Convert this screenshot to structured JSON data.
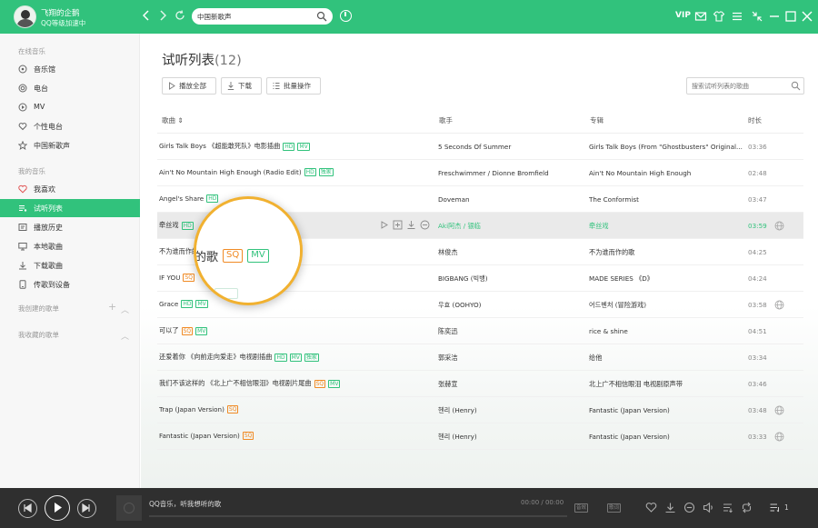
{
  "user": {
    "name": "飞翔的企鹅",
    "status": "QQ等级加速中"
  },
  "search": {
    "value": "中国新歌声"
  },
  "header": {
    "vip": "VIP"
  },
  "sidebar": {
    "section_online": "在线音乐",
    "online_items": [
      {
        "label": "音乐馆",
        "icon": "music-hall-icon"
      },
      {
        "label": "电台",
        "icon": "radio-icon"
      },
      {
        "label": "MV",
        "icon": "mv-icon"
      },
      {
        "label": "个性电台",
        "icon": "heart-radio-icon"
      },
      {
        "label": "中国新歌声",
        "icon": "star-icon"
      }
    ],
    "section_my": "我的音乐",
    "my_items": [
      {
        "label": "我喜欢",
        "icon": "heart-icon"
      },
      {
        "label": "试听列表",
        "icon": "list-icon"
      },
      {
        "label": "播放历史",
        "icon": "history-icon"
      },
      {
        "label": "本地歌曲",
        "icon": "monitor-icon"
      },
      {
        "label": "下载歌曲",
        "icon": "download-icon"
      },
      {
        "label": "传歌到设备",
        "icon": "device-icon"
      }
    ],
    "section_created": "我创建的歌单",
    "section_collected": "我收藏的歌单"
  },
  "page": {
    "title": "试听列表",
    "count": "(12)",
    "play_all": "播放全部",
    "download": "下载",
    "batch": "批量操作",
    "search_placeholder": "搜索试听列表的歌曲"
  },
  "table": {
    "headers": {
      "song": "歌曲 ⇕",
      "singer": "歌手",
      "album": "专辑",
      "duration": "时长"
    },
    "rows": [
      {
        "song": "Girls Talk Boys 《超能敢死队》电影插曲",
        "tags": [
          "HD",
          "MV"
        ],
        "singer": "5 Seconds Of Summer",
        "album": "Girls Talk Boys (From \"Ghostbusters\" Original...",
        "duration": "03:36",
        "globe": false
      },
      {
        "song": "Ain't No Mountain High Enough (Radio Edit)",
        "tags": [
          "HD",
          "独家"
        ],
        "singer": "Freschwimmer / Dionne Bromfield",
        "album": "Ain't No Mountain High Enough",
        "duration": "02:48",
        "globe": false
      },
      {
        "song": "Angel's Share",
        "tags": [
          "HD"
        ],
        "singer": "Doveman",
        "album": "The Conformist",
        "duration": "03:47",
        "globe": false
      },
      {
        "song": "牵丝戏",
        "tags": [
          "HD"
        ],
        "singer": "Aki阿杰 / 银临",
        "album": "牵丝戏",
        "duration": "03:59",
        "globe": true,
        "hover": true
      },
      {
        "song": "不为谁而作的歌",
        "tags": [
          "SQ",
          "MV"
        ],
        "singer": "林俊杰",
        "album": "不为谁而作的歌",
        "duration": "04:25",
        "globe": false
      },
      {
        "song": "IF YOU",
        "tags": [
          "SQ"
        ],
        "singer": "BIGBANG (빅뱅)",
        "album": "MADE SERIES 《D》",
        "duration": "04:24",
        "globe": false
      },
      {
        "song": "Grace",
        "tags": [
          "HD",
          "MV"
        ],
        "singer": "우효 (OOHYO)",
        "album": "어드벤처 (冒险游戏)",
        "duration": "03:58",
        "globe": true
      },
      {
        "song": "可以了",
        "tags": [
          "SQ",
          "MV"
        ],
        "singer": "陈奕迅",
        "album": "rice & shine",
        "duration": "04:51",
        "globe": false
      },
      {
        "song": "还爱着你 《向前走向爱走》电视剧插曲",
        "tags": [
          "HD",
          "MV",
          "独家"
        ],
        "singer": "郭采洁",
        "album": "给他",
        "duration": "03:34",
        "globe": false
      },
      {
        "song": "我们不该这样的 《北上广不相信眼泪》电视剧片尾曲",
        "tags": [
          "SQ",
          "MV"
        ],
        "singer": "张赫宣",
        "album": "北上广不相信眼泪 电视剧原声带",
        "duration": "03:46",
        "globe": false
      },
      {
        "song": "Trap (Japan Version)",
        "tags": [
          "SQ"
        ],
        "singer": "헨리 (Henry)",
        "album": "Fantastic (Japan Version)",
        "duration": "03:48",
        "globe": true
      },
      {
        "song": "Fantastic (Japan Version)",
        "tags": [
          "SQ"
        ],
        "singer": "헨리 (Henry)",
        "album": "Fantastic (Japan Version)",
        "duration": "03:33",
        "globe": true
      }
    ]
  },
  "magnifier": {
    "text": "的歌",
    "tags": [
      "SQ",
      "MV"
    ]
  },
  "player": {
    "now_playing": "QQ音乐，听我想听的歌",
    "time": "00:00 / 00:00",
    "tag_sq": "音效",
    "tag_lyric": "歌词",
    "queue_count": "1"
  },
  "colors": {
    "accent": "#31c27c",
    "sq": "#f08a24",
    "magnifier_ring": "#f1b130",
    "player_bg": "#2f2f2f"
  }
}
